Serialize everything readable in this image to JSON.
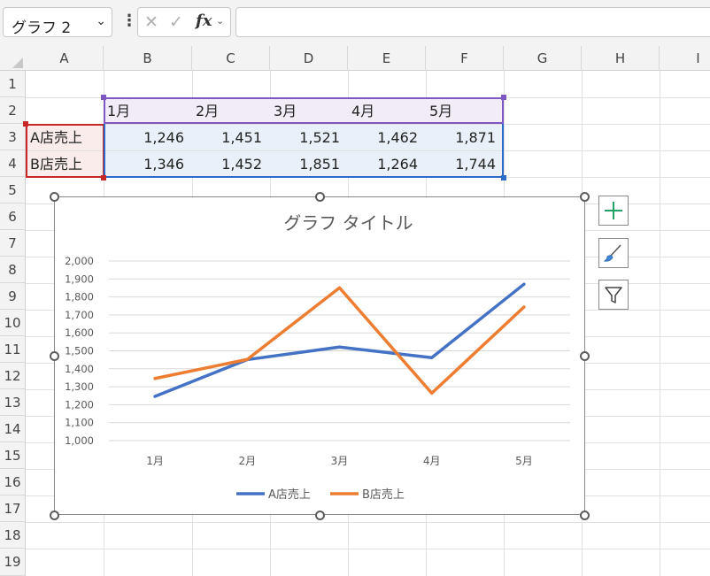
{
  "name_box": {
    "value": "グラフ 2"
  },
  "formula_bar": {
    "fx_label": "fx",
    "content": ""
  },
  "columns": [
    "A",
    "B",
    "C",
    "D",
    "E",
    "F",
    "G",
    "H",
    "I"
  ],
  "rows": [
    "1",
    "2",
    "3",
    "4",
    "5",
    "6",
    "7",
    "8",
    "9",
    "10",
    "11",
    "12",
    "13",
    "14",
    "15",
    "16",
    "17",
    "18",
    "19"
  ],
  "sheet": {
    "months": [
      "1月",
      "2月",
      "3月",
      "4月",
      "5月"
    ],
    "row_a": {
      "label": "A店売上",
      "values": [
        "1,246",
        "1,451",
        "1,521",
        "1,462",
        "1,871"
      ]
    },
    "row_b": {
      "label": "B店売上",
      "values": [
        "1,346",
        "1,452",
        "1,851",
        "1,264",
        "1,744"
      ]
    }
  },
  "colors": {
    "series_a": "#4472c4",
    "series_b": "#ed7d31",
    "selection_purple": "#7e57c2",
    "selection_red": "#c62828",
    "selection_blue": "#2e6bc8"
  },
  "chart_side_buttons": [
    "plus-icon",
    "brush-icon",
    "filter-icon"
  ],
  "chart_data": {
    "type": "line",
    "title": "グラフ タイトル",
    "categories": [
      "1月",
      "2月",
      "3月",
      "4月",
      "5月"
    ],
    "series": [
      {
        "name": "A店売上",
        "values": [
          1246,
          1451,
          1521,
          1462,
          1871
        ],
        "color": "#4472c4"
      },
      {
        "name": "B店売上",
        "values": [
          1346,
          1452,
          1851,
          1264,
          1744
        ],
        "color": "#ed7d31"
      }
    ],
    "ylim": [
      1000,
      2000
    ],
    "yticks": [
      "1,000",
      "1,100",
      "1,200",
      "1,300",
      "1,400",
      "1,500",
      "1,600",
      "1,700",
      "1,800",
      "1,900",
      "2,000"
    ],
    "grid": true,
    "legend": "bottom"
  }
}
